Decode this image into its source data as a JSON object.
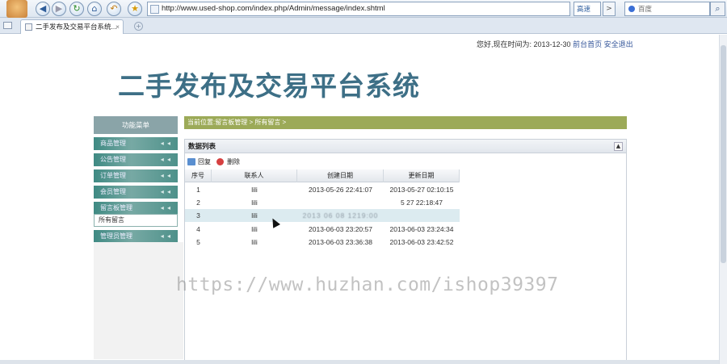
{
  "browser": {
    "url": "http://www.used-shop.com/index.php/Admin/message/index.shtml",
    "search_engine": "高速",
    "search_placeholder": "百度",
    "tab_title": "二手发布及交易平台系统..."
  },
  "header": {
    "greeting": "您好,现在时间为: 2013-12-30",
    "link_home": "前台首页",
    "link_logout": "安全退出",
    "title": "二手发布及交易平台系统"
  },
  "sidebar": {
    "heading": "功能菜单",
    "items": [
      {
        "label": "商品管理"
      },
      {
        "label": "公告管理"
      },
      {
        "label": "订单管理"
      },
      {
        "label": "会员管理"
      },
      {
        "label": "留言板管理"
      },
      {
        "label": "管理员管理"
      }
    ],
    "submenu_item": "所有留言"
  },
  "main": {
    "breadcrumb": "当前位置:留言板管理 > 所有留言 >",
    "panel_title": "数据列表",
    "toolbar": {
      "reply": "回复",
      "delete": "删除"
    },
    "table": {
      "columns": [
        "序号",
        "联系人",
        "创建日期",
        "更新日期"
      ],
      "rows": [
        [
          "1",
          "lili",
          "2013-05-26 22:41:07",
          "2013-05-27 02:10:15"
        ],
        [
          "2",
          "lili",
          "",
          "5 27 22:18:47"
        ],
        [
          "3",
          "lili",
          "2013 06 08 1219:00",
          ""
        ],
        [
          "4",
          "lili",
          "2013-06-03 23:20:57",
          "2013-06-03 23:24:34"
        ],
        [
          "5",
          "lili",
          "2013-06-03 23:36:38",
          "2013-06-03 23:42:52"
        ]
      ]
    }
  },
  "watermark": "https://www.huzhan.com/ishop39397",
  "colors": {
    "title": "#3d6f86",
    "breadcrumb_bg": "#9caa58",
    "menu_teal": "#4e918a",
    "row_highlight": "#dcebf0"
  }
}
